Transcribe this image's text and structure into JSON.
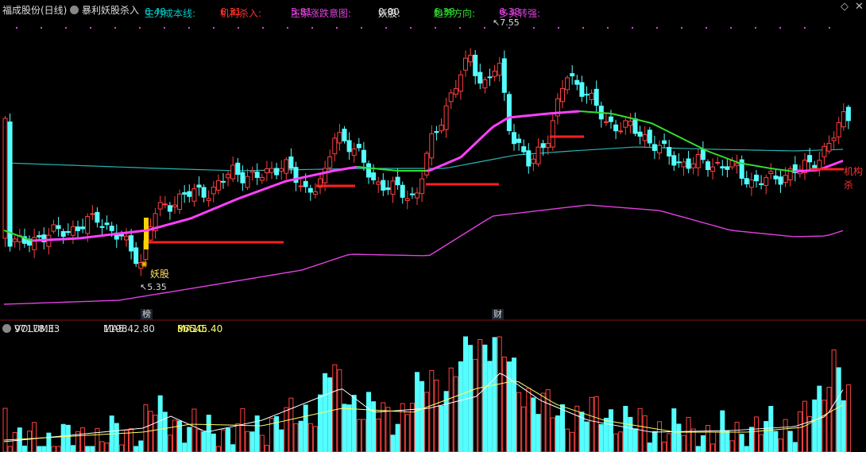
{
  "header": {
    "stock_name": "福成股份(日线)",
    "indicator_name": "暴利妖股杀入",
    "items": [
      {
        "label": "主力成本线: ",
        "value": "6.48",
        "color": "#00c8c8"
      },
      {
        "label": "机构杀入: ",
        "value": "6.31",
        "color": "#ff3030"
      },
      {
        "label": "庄家涨跌意图: ",
        "value": "5.81",
        "color": "#e040e0"
      },
      {
        "label": "妖股: ",
        "value": "0.00",
        "color": "#dddddd"
      },
      {
        "label": "趋势方向: ",
        "value": "6.38",
        "color": "#30e030"
      },
      {
        "label": "多头转强: ",
        "value": "6.38",
        "color": "#e040e0"
      }
    ]
  },
  "annotations": {
    "high_price": "7.55",
    "low_price": "5.35",
    "yaogu_label": "妖股",
    "jigou_label": "机构杀",
    "bang_tag": "榜",
    "cai_tag": "财"
  },
  "volume_header": {
    "name": "VOLUME: ",
    "value": "97178.33",
    "ma5_label": "MA5: ",
    "ma5_value": "119842.80",
    "ma10_label": "MA10: ",
    "ma10_value": "86545.40"
  },
  "colors": {
    "up": "#ff4040",
    "down": "#54ffff",
    "ma_white": "#ffffff",
    "ma_yellow": "#ffff66",
    "cost_line": "#28b4b4",
    "trend_line": "#30e030",
    "strong_line": "#ff40ff",
    "intent_line": "#e040e0",
    "jigou_line": "#ff2020"
  },
  "icons": {
    "collapse": "circle-chevron-icon",
    "settings": "diamond-icon",
    "close": "close-icon"
  }
}
